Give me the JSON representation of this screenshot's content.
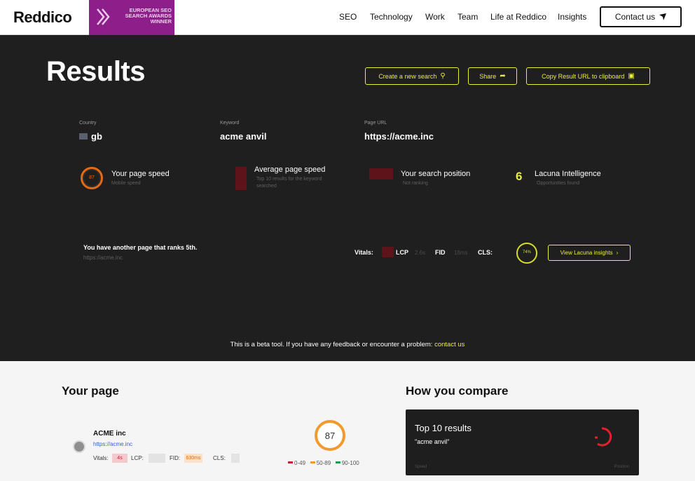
{
  "header": {
    "logo": "Reddico",
    "award": "EUROPEAN SEO SEARCH AWARDS WINNER",
    "nav": [
      "SEO",
      "Technology",
      "Work",
      "Team",
      "Life at Reddico",
      "Insights"
    ],
    "contact": "Contact us"
  },
  "hero": {
    "title": "Results",
    "buttons": {
      "new_search": "Create a new search",
      "share": "Share",
      "copy_url": "Copy Result URL to clipboard"
    },
    "fields": [
      {
        "label": "Country",
        "value": "gb"
      },
      {
        "label": "Keyword",
        "value": "acme anvil"
      },
      {
        "label": "Page URL",
        "value": "https://acme.inc"
      }
    ],
    "metrics": {
      "page_speed": {
        "title": "Your page speed",
        "sub": "Mobile speed",
        "ring_value": "87"
      },
      "avg_speed": {
        "title": "Average page speed",
        "sub": "Top 10 results for the keyword searched"
      },
      "search_position": {
        "title": "Your search position",
        "sub": "Not ranking"
      },
      "lacuna": {
        "title": "Lacuna Intelligence",
        "number": "6",
        "sub": "Opportunities found"
      }
    },
    "another": {
      "title": "You have another page that ranks 5th.",
      "url": "https://acme.inc",
      "vitals_label": "Vitals:",
      "lcp_label": "LCP",
      "fid_label": "FID",
      "cls_label": "CLS:",
      "lcp_value": "2.6s",
      "fid_value": "18ms",
      "lacuna_score": "74%",
      "view_button": "View Lacuna insights"
    },
    "beta_text": "This is a beta tool. If you have any feedback or encounter a problem: ",
    "beta_link": "contact us"
  },
  "your_page": {
    "heading": "Your page",
    "site_name": "ACME inc",
    "site_url": "https://acme.inc",
    "vitals_label": "Vitals:",
    "vitals_bad": "4s",
    "lcp_label": "LCP:",
    "fid_label": "FID:",
    "fid_value": "630ms",
    "cls_label": "CLS:",
    "score": "87",
    "legend": [
      "0-49",
      "50-89",
      "90-100"
    ],
    "legend_colors": [
      "#c41d2c",
      "#f29a2e",
      "#1a9e4e"
    ]
  },
  "compare": {
    "heading": "How you compare",
    "card_title": "Top 10 results",
    "card_query": "\"acme anvil\"",
    "foot_left": "Speed",
    "foot_right": "Position"
  },
  "colors": {
    "accent": "#e8ee3a",
    "hero_bg": "#201f1f",
    "award": "#8e1f8a"
  }
}
